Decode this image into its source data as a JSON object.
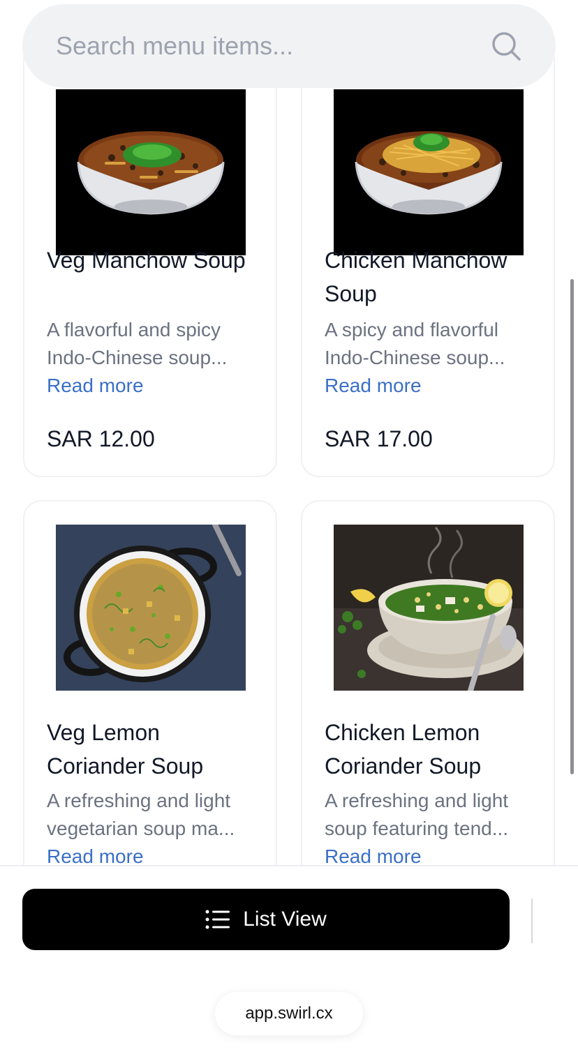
{
  "search": {
    "placeholder": "Search menu items..."
  },
  "items": [
    {
      "title": "Veg Manchow Soup",
      "description": "A flavorful and spicy Indo-Chinese soup...",
      "read_more": "Read more",
      "price": "SAR 12.00"
    },
    {
      "title": "Chicken Manchow Soup",
      "description": "A spicy and flavorful Indo-Chinese soup...",
      "read_more": "Read more",
      "price": "SAR 17.00"
    },
    {
      "title": "Veg Lemon Coriander Soup",
      "description": "A refreshing and light vegetarian soup ma...",
      "read_more": "Read more"
    },
    {
      "title": "Chicken Lemon Coriander Soup",
      "description": "A refreshing and light soup featuring tend...",
      "read_more": "Read more"
    }
  ],
  "bottom": {
    "list_view_label": "List View",
    "url": "app.swirl.cx"
  },
  "colors": {
    "accent_link": "#3b6fc6",
    "button_bg": "#000000",
    "search_bg": "#f1f2f4"
  }
}
